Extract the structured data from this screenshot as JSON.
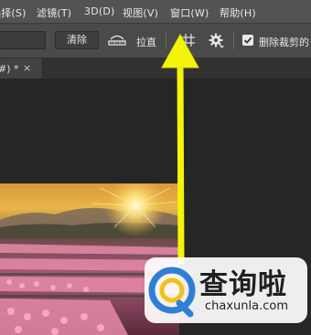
{
  "menubar": {
    "items": [
      {
        "label": "选择(S)"
      },
      {
        "label": "滤镜(T)"
      },
      {
        "label": "3D(D)"
      },
      {
        "label": "视图(V)"
      },
      {
        "label": "窗口(W)"
      },
      {
        "label": "帮助(H)"
      }
    ]
  },
  "options": {
    "clear_label": "清除",
    "straighten_label": "拉直",
    "delete_cropped_label": "删除裁剪的",
    "delete_cropped_checked": true
  },
  "document": {
    "tab_label": "#) *",
    "close_glyph": "×"
  },
  "colors": {
    "arrow": "#f4f40a",
    "menubar_bg": "#535353",
    "canvas_bg": "#262626",
    "watermark_blue": "#2f7fd4"
  },
  "watermark": {
    "text": "查询啦",
    "url": "chaxunla.com"
  },
  "icons": [
    "straighten-icon",
    "grid-icon",
    "gear-icon",
    "close-icon",
    "arrow-icon"
  ]
}
